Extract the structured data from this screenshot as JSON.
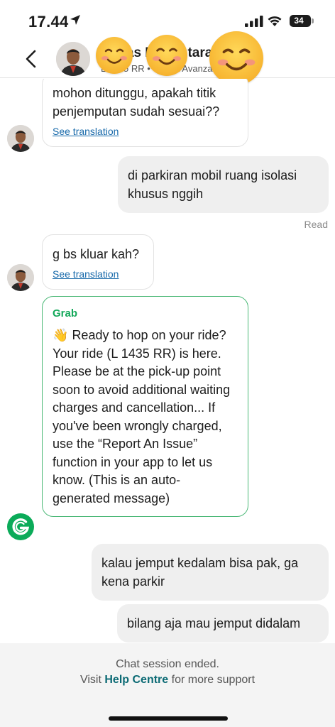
{
  "status_bar": {
    "time": "17.44",
    "battery": "34",
    "icons": [
      "location-arrow-icon",
      "signal-icon",
      "wifi-icon",
      "battery-icon"
    ]
  },
  "header": {
    "name": "Dimas Dirgantara Ra...",
    "subtitle": "L 1435 RR • Toyota Avanza Xenia",
    "back_icon": "chevron-left-icon"
  },
  "messages": [
    {
      "direction": "incoming",
      "text": "mohon ditunggu, apakah titik penjemputan sudah sesuai??",
      "translate_label": "See translation"
    },
    {
      "direction": "outgoing",
      "text": "di parkiran mobil ruang isolasi khusus nggih",
      "status": "Read"
    },
    {
      "direction": "incoming",
      "text": "g bs kluar kah?",
      "translate_label": "See translation"
    },
    {
      "direction": "incoming",
      "sender": "Grab",
      "emoji": "👋",
      "text": "Ready to hop on your ride? Your ride (L 1435 RR) is here. Please be at the pick-up point soon to avoid additional waiting charges and cancellation... If you've been wrongly charged, use the “Report An Issue” function in your app to let us know. (This is an auto-generated message)"
    },
    {
      "direction": "outgoing",
      "text": "kalau jemput kedalam bisa pak, ga kena parkir"
    },
    {
      "direction": "outgoing",
      "text": "bilang aja mau jemput didalam"
    }
  ],
  "footer": {
    "ended_text": "Chat session ended.",
    "visit_text": "Visit",
    "help_link": "Help Centre",
    "suffix_text": "for more support"
  },
  "colors": {
    "grab_green": "#14a85a",
    "link_blue": "#1769aa",
    "help_teal": "#0b6a74",
    "outgoing_bg": "#efefef"
  }
}
